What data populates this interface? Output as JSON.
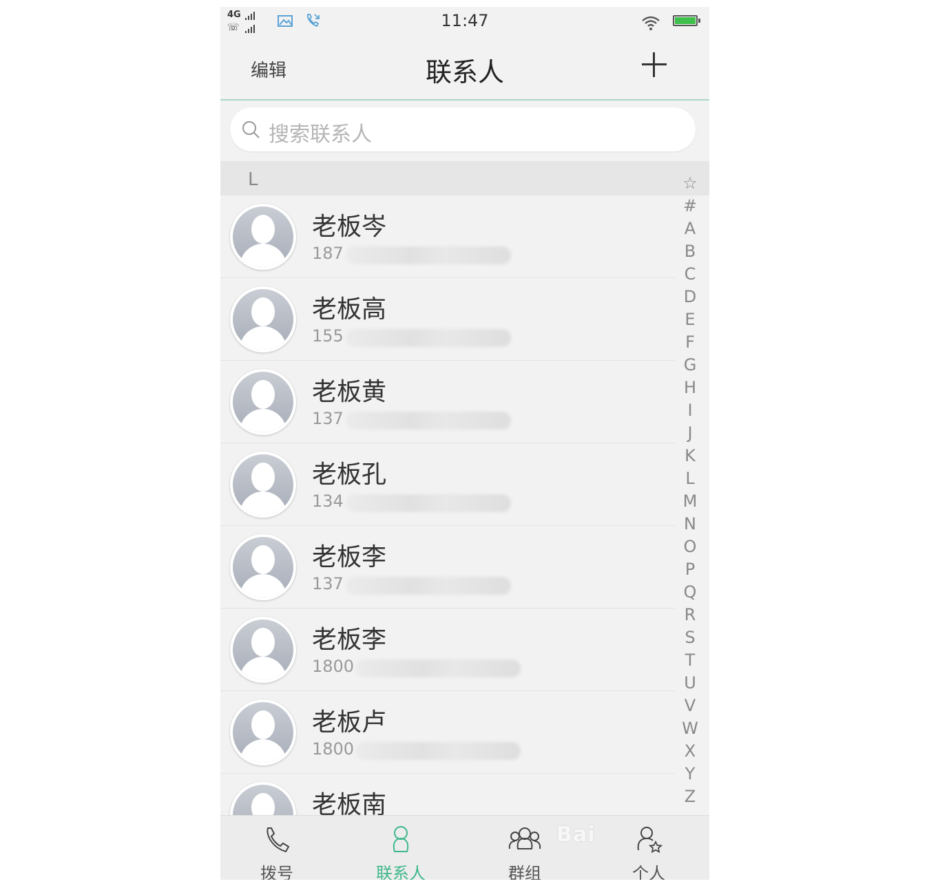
{
  "status_bar": {
    "network": "4G",
    "time": "11:47"
  },
  "header": {
    "edit_label": "编辑",
    "title": "联系人",
    "add_icon": "plus-icon"
  },
  "search": {
    "placeholder": "搜索联系人"
  },
  "section": {
    "letter": "L"
  },
  "contacts": [
    {
      "name": "老板岑",
      "phone": "187"
    },
    {
      "name": "老板高",
      "phone": "155"
    },
    {
      "name": "老板黄",
      "phone": "137"
    },
    {
      "name": "老板孔",
      "phone": "134"
    },
    {
      "name": "老板李",
      "phone": "137"
    },
    {
      "name": "老板李",
      "phone": "1800"
    },
    {
      "name": "老板卢",
      "phone": "1800"
    },
    {
      "name": "老板南",
      "phone": ""
    }
  ],
  "index_letters": [
    "☆",
    "#",
    "A",
    "B",
    "C",
    "D",
    "E",
    "F",
    "G",
    "H",
    "I",
    "J",
    "K",
    "L",
    "M",
    "N",
    "O",
    "P",
    "Q",
    "R",
    "S",
    "T",
    "U",
    "V",
    "W",
    "X",
    "Y",
    "Z"
  ],
  "tabs": [
    {
      "label": "拨号",
      "icon": "phone-icon",
      "active": false
    },
    {
      "label": "联系人",
      "icon": "contacts-icon",
      "active": true
    },
    {
      "label": "群组",
      "icon": "groups-icon",
      "active": false
    },
    {
      "label": "个人",
      "icon": "profile-star-icon",
      "active": false
    }
  ],
  "colors": {
    "accent": "#3fb88b",
    "background": "#f2f2f2",
    "battery": "#3fbf4b"
  },
  "watermark": "Bai"
}
